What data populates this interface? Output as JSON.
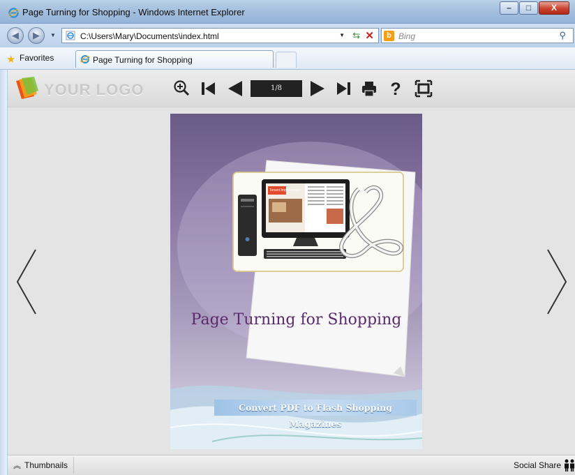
{
  "window": {
    "title": "Page Turning for Shopping - Windows Internet Explorer",
    "minimize_glyph": "–",
    "maximize_glyph": "□",
    "close_glyph": "X"
  },
  "address_bar": {
    "url": "C:\\Users\\Mary\\Documents\\index.html",
    "search_placeholder": "Bing"
  },
  "favorites_bar": {
    "favorites_label": "Favorites",
    "tab_label": "Page Turning for Shopping"
  },
  "viewer": {
    "logo_text": "YOUR LOGO",
    "page_indicator": "1/8",
    "book": {
      "title": "Page Turning for Shopping",
      "banner": "Convert PDF to  Flash Shopping Magazines",
      "magazine_heading": "Tenant Improvement"
    },
    "thumbnails_label": "Thumbnails",
    "social_share_label": "Social Share"
  },
  "colors": {
    "titlebar": "#a5c0de",
    "close_button": "#c94330",
    "cover_purple": "#6a5a86",
    "title_purple": "#5b2a6d",
    "banner_blue": "#9ec3e6"
  },
  "icons": [
    "ie-icon",
    "back-icon",
    "forward-icon",
    "refresh-icon",
    "stop-icon",
    "bing-icon",
    "search-icon",
    "favorites-star-icon",
    "zoom-in-icon",
    "first-page-icon",
    "previous-page-icon",
    "next-page-icon",
    "last-page-icon",
    "print-icon",
    "help-icon",
    "fullscreen-icon",
    "prev-arrow-icon",
    "next-arrow-icon",
    "thumbnails-icon",
    "social-share-icon"
  ]
}
